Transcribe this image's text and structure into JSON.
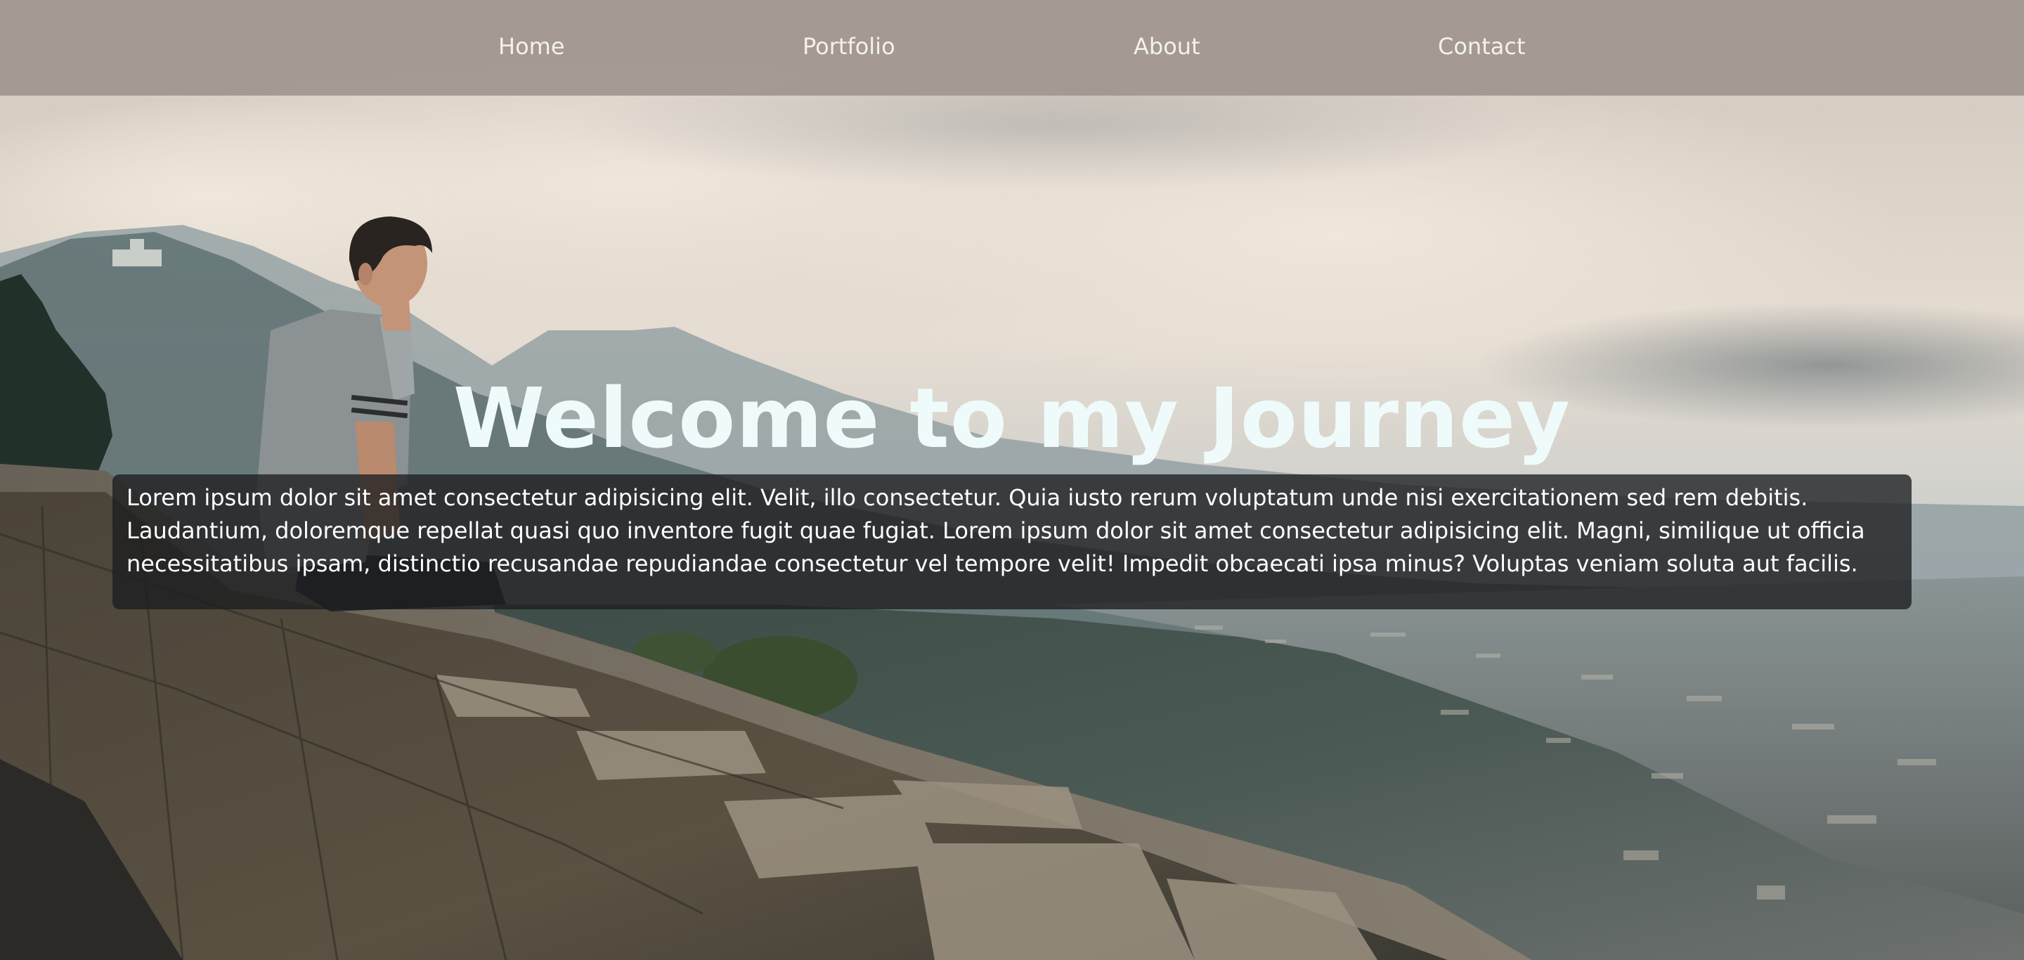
{
  "nav": {
    "items": [
      {
        "label": "Home"
      },
      {
        "label": "Portfolio"
      },
      {
        "label": "About"
      },
      {
        "label": "Contact"
      }
    ]
  },
  "hero": {
    "title": "Welcome to my Journey",
    "paragraph": "Lorem ipsum dolor sit amet consectetur adipisicing elit. Velit, illo consectetur. Quia iusto rerum voluptatum unde nisi exercitationem sed rem debitis. Laudantium, doloremque repellat quasi quo inventore fugit quae fugiat. Lorem ipsum dolor sit amet consectetur adipisicing elit. Magni, similique ut officia necessitatibus ipsam, distinctio recusandae repudiandae consectetur vel tempore velit! Impedit obcaecati ipsa minus? Voluptas veniam soluta aut facilis."
  },
  "colors": {
    "nav_background": "#a0968e",
    "title": "#effbfb",
    "text_panel": "#1c1e20"
  }
}
